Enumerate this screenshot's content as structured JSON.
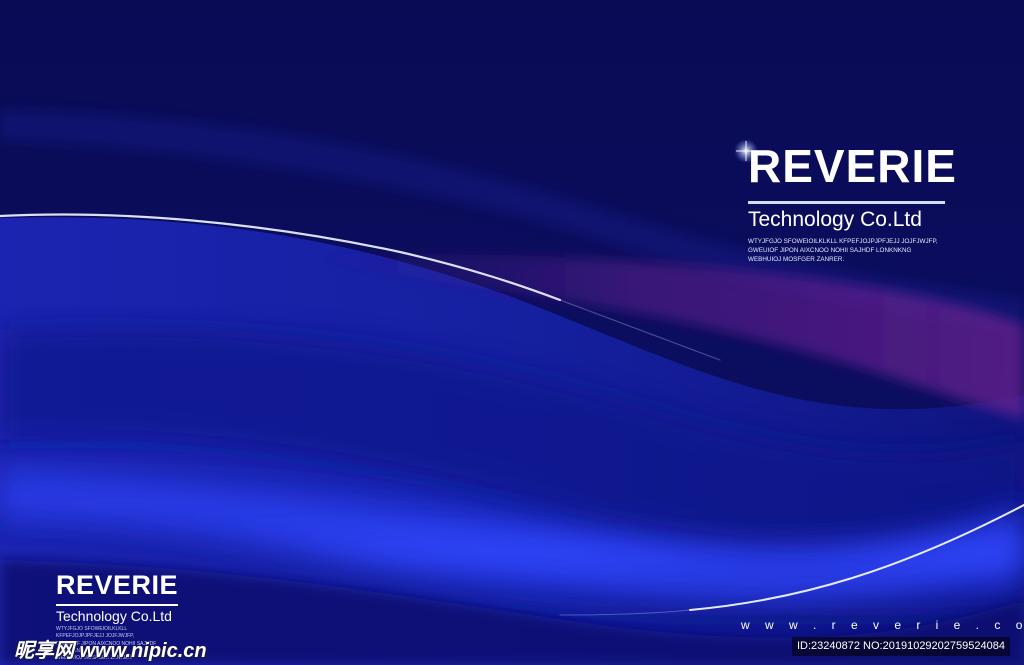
{
  "brand_main": {
    "title": "REVERIE",
    "subtitle": "Technology   Co.Ltd",
    "fine_print": "WTYJFGJO SFOWEIOILKLKLL KFPEFJOJPJPFJEJJ JOJFJWJFP,\nGWEUIOF JIPON AIXCNOO NOHII SAJHDF LONKNKNG\nWEBHUIOJ MOSFGER ZANRER."
  },
  "brand_small": {
    "title": "REVERIE",
    "subtitle": "Technology  Co.Ltd",
    "fine_print": "WTYJFGJO SFOWEIOILKLKLL KFPEFJOJPJPFJEJJ JOJFJWJFP,\nGWEUIOF JIPON AIXCNOO NOHII SAJHDF LONKNKNG\nWEBHUIOJ MOSFGER ZANRER."
  },
  "website": "w w w . r e v e r i e . c o m .",
  "watermark": {
    "site": "昵享网 www.nipic.cn",
    "id_text": "ID:23240872 NO:20191029202759524084"
  },
  "colors": {
    "background": "#0b0d5e",
    "wave_bright": "#2a3cff",
    "accent_purple": "#5a1f8a",
    "text": "#ffffff"
  }
}
